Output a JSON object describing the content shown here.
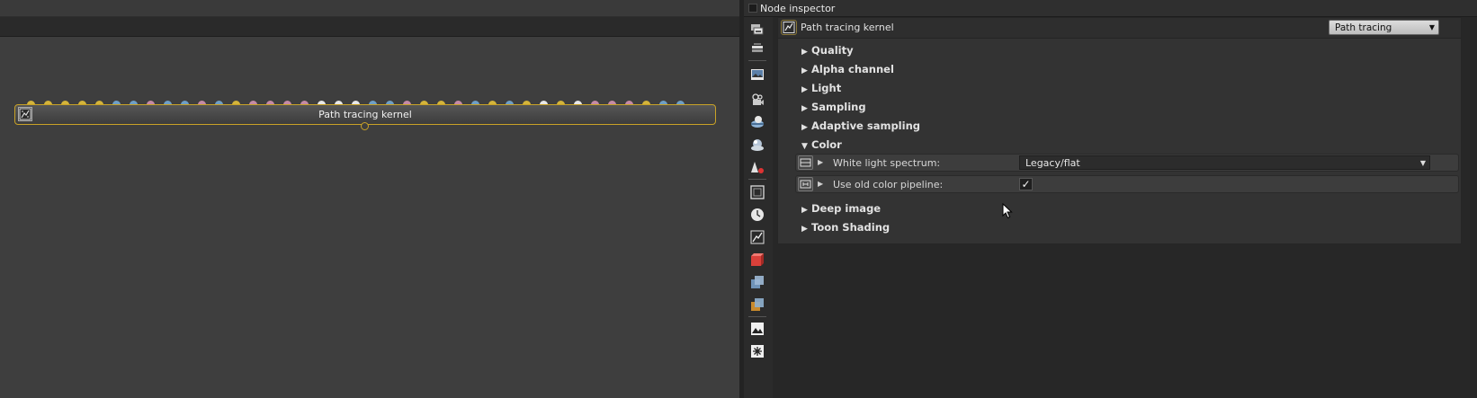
{
  "graph": {
    "node": {
      "label": "Path tracing kernel",
      "pin_colors": [
        "#d4b43a",
        "#d4b43a",
        "#d4b43a",
        "#d4b43a",
        "#d4b43a",
        "#6f9fc6",
        "#6f9fc6",
        "#c58aa6",
        "#6f9fc6",
        "#6f9fc6",
        "#c58aa6",
        "#6f9fc6",
        "#d4b43a",
        "#c58aa6",
        "#c58aa6",
        "#c58aa6",
        "#c58aa6",
        "#e8e8e8",
        "#e8e8e8",
        "#e8e8e8",
        "#6f9fc6",
        "#6f9fc6",
        "#c58aa6",
        "#d4b43a",
        "#d4b43a",
        "#c58aa6",
        "#6f9fc6",
        "#d4b43a",
        "#6f9fc6",
        "#d4b43a",
        "#e8e8e8",
        "#d4b43a",
        "#e8e8e8",
        "#c58aa6",
        "#c58aa6",
        "#c58aa6",
        "#d4b43a",
        "#6f9fc6",
        "#6f9fc6"
      ]
    }
  },
  "inspector": {
    "title": "Node inspector",
    "toolbar_icons": [
      "render-target-icon",
      "layers-icon",
      "image-icon",
      "camera-icon",
      "environment-icon",
      "material-icon",
      "geometry-icon",
      "film-icon",
      "clock-icon",
      "kernel-icon",
      "red-cube-icon",
      "blue-cube-icon",
      "orange-cube-icon",
      "imager-icon",
      "light-icon"
    ],
    "kernel": {
      "label": "Path tracing kernel",
      "type_value": "Path tracing"
    },
    "categories_top": [
      {
        "label": "Quality",
        "expanded": false
      },
      {
        "label": "Alpha channel",
        "expanded": false
      },
      {
        "label": "Light",
        "expanded": false
      },
      {
        "label": "Sampling",
        "expanded": false
      },
      {
        "label": "Adaptive sampling",
        "expanded": false
      },
      {
        "label": "Color",
        "expanded": true
      }
    ],
    "color_attrs": {
      "white_light": {
        "label": "White light spectrum:",
        "value": "Legacy/flat"
      },
      "old_pipeline": {
        "label": "Use old color pipeline:",
        "checked": "✓"
      }
    },
    "categories_bottom": [
      {
        "label": "Deep image",
        "expanded": false
      },
      {
        "label": "Toon Shading",
        "expanded": false
      }
    ],
    "glyphs": {
      "collapsed": "▶",
      "expanded": "▼",
      "dropdown": "▼"
    }
  }
}
